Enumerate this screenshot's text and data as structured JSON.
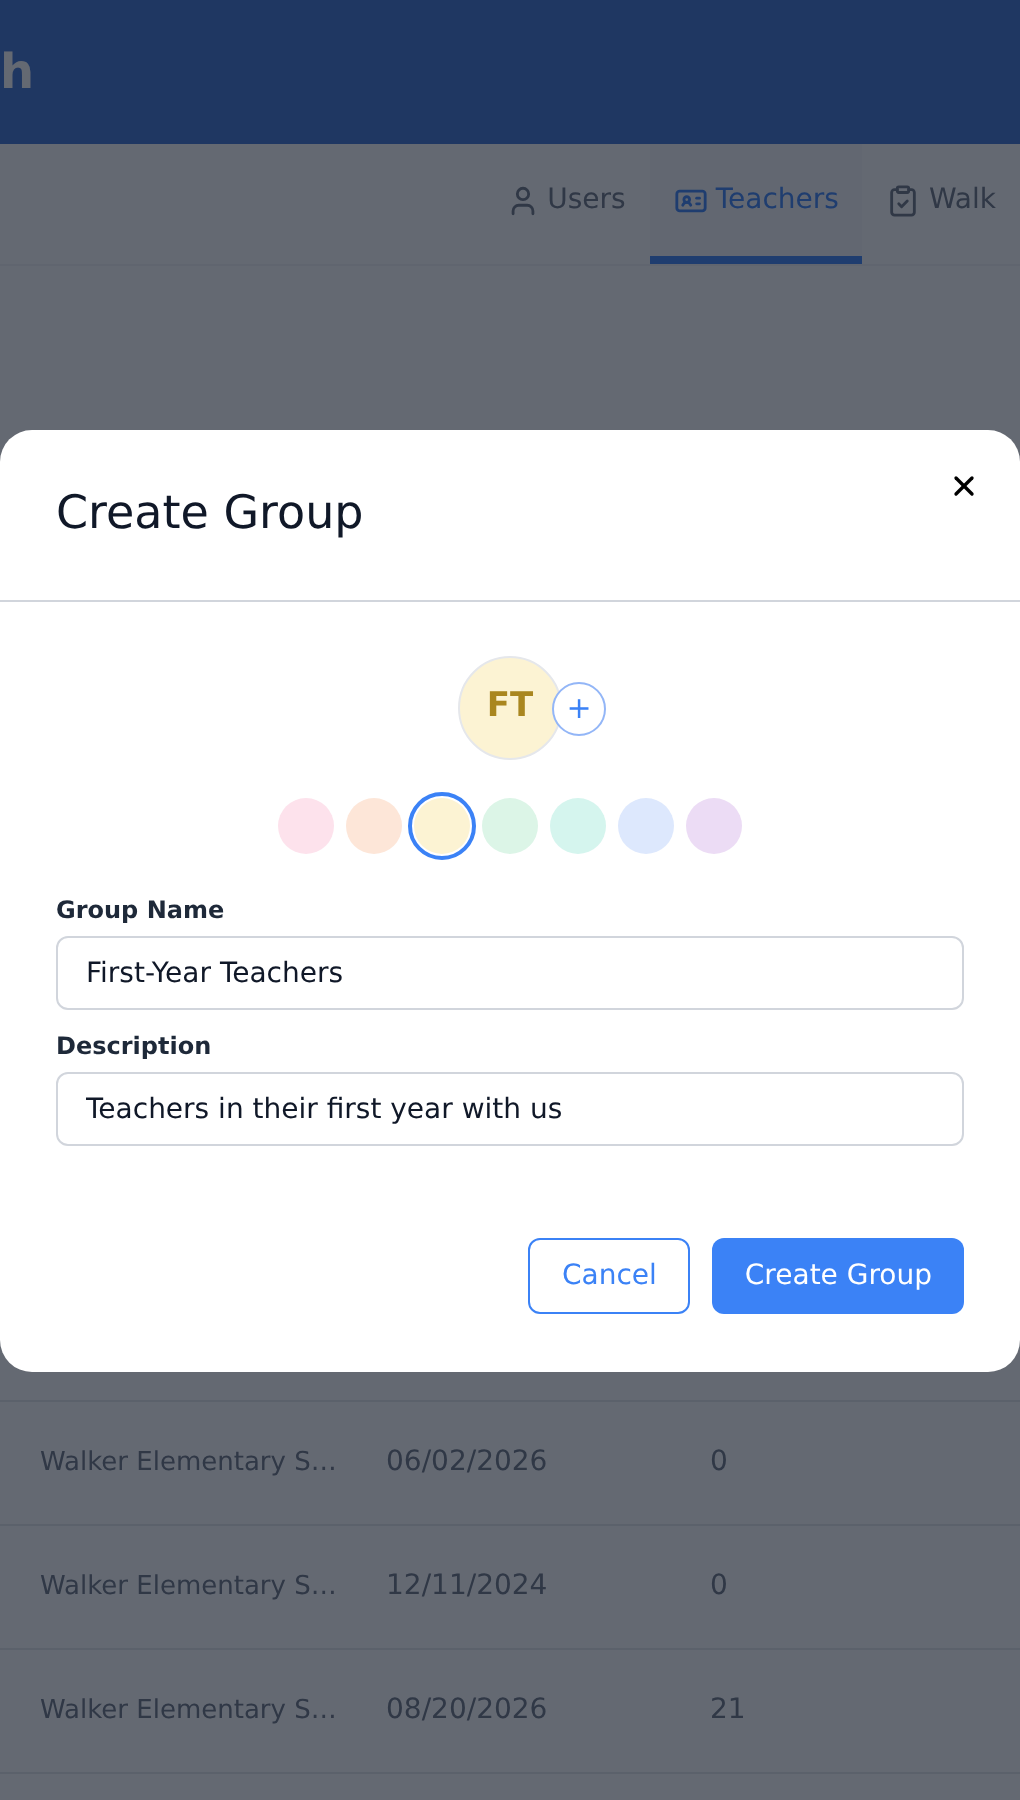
{
  "header": {
    "title": "h"
  },
  "tabs": [
    {
      "label": "Users",
      "selected": false
    },
    {
      "label": "Teachers",
      "selected": true
    },
    {
      "label": "Walk",
      "selected": false
    }
  ],
  "table": {
    "rows": [
      {
        "school": "Walker Elementary S…",
        "date": "06/02/2026",
        "count": "0"
      },
      {
        "school": "Walker Elementary S…",
        "date": "12/11/2024",
        "count": "0"
      },
      {
        "school": "Walker Elementary S…",
        "date": "08/20/2026",
        "count": "21"
      }
    ]
  },
  "dialog": {
    "title": "Create Group",
    "avatar_initials": "FT",
    "add_icon": "+",
    "swatches": [
      {
        "color": "#fde2ec",
        "selected": false
      },
      {
        "color": "#fde6d8",
        "selected": false
      },
      {
        "color": "#fcf3d3",
        "selected": true
      },
      {
        "color": "#dcf5e7",
        "selected": false
      },
      {
        "color": "#d5f5ee",
        "selected": false
      },
      {
        "color": "#dde8fd",
        "selected": false
      },
      {
        "color": "#ecdcf5",
        "selected": false
      }
    ],
    "fields": [
      {
        "label": "Group Name",
        "value": "First-Year Teachers"
      },
      {
        "label": "Description",
        "value": "Teachers in their first year with us"
      }
    ],
    "buttons": [
      {
        "label": "Cancel",
        "kind": "secondary"
      },
      {
        "label": "Create Group",
        "kind": "primary"
      }
    ]
  }
}
